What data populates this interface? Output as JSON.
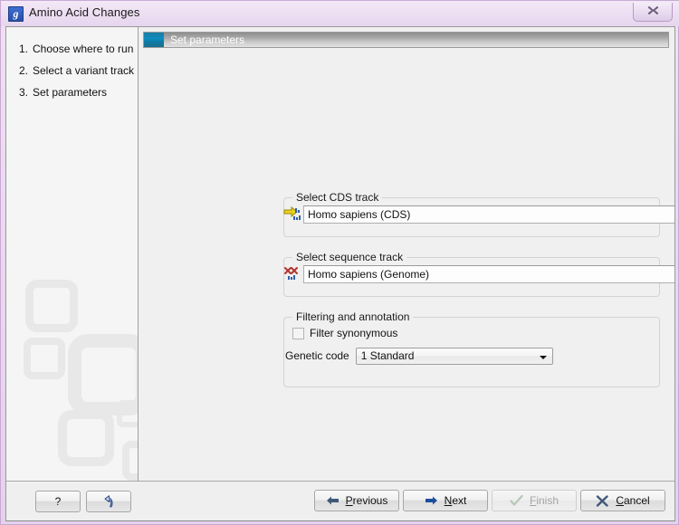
{
  "window": {
    "title": "Amino Acid Changes",
    "app_icon": "g",
    "close_label": "✕"
  },
  "sidebar": {
    "steps": [
      {
        "num": "1.",
        "label": "Choose where to run"
      },
      {
        "num": "2.",
        "label": "Select a variant track"
      },
      {
        "num": "3.",
        "label": "Set parameters"
      }
    ]
  },
  "header": {
    "title": "Set parameters",
    "icon": "teal-square-icon"
  },
  "groups": {
    "cds": {
      "title": "Select CDS track",
      "value": "Homo sapiens (CDS)",
      "icon": "cds-track-icon",
      "browse_icon": "folder-search-icon"
    },
    "sequence": {
      "title": "Select sequence track",
      "value": "Homo sapiens (Genome)",
      "icon": "genome-track-icon",
      "browse_icon": "folder-search-icon"
    },
    "filtering": {
      "title": "Filtering and annotation",
      "checkbox_label": "Filter synonymous",
      "checkbox_checked": false,
      "genetic_code_label": "Genetic code",
      "genetic_code_value": "1 Standard",
      "genetic_code_options": [
        "1 Standard"
      ]
    }
  },
  "buttons": {
    "help": "?",
    "reset_icon": "undo-arrow-icon",
    "previous": {
      "pre": "",
      "mnemonic": "P",
      "post": "revious",
      "icon": "arrow-left-icon"
    },
    "next": {
      "pre": "",
      "mnemonic": "N",
      "post": "ext",
      "icon": "arrow-right-icon"
    },
    "finish": {
      "pre": "",
      "mnemonic": "F",
      "post": "inish",
      "icon": "check-icon",
      "disabled": true
    },
    "cancel": {
      "pre": "",
      "mnemonic": "C",
      "post": "ancel",
      "icon": "x-icon"
    }
  },
  "colors": {
    "frame": "#e4d2ec",
    "header_icon": "#0e8cbe",
    "cds_icon": "#e8c80a",
    "genome_icon": "#b3342e",
    "accent_blue": "#2550a8"
  }
}
